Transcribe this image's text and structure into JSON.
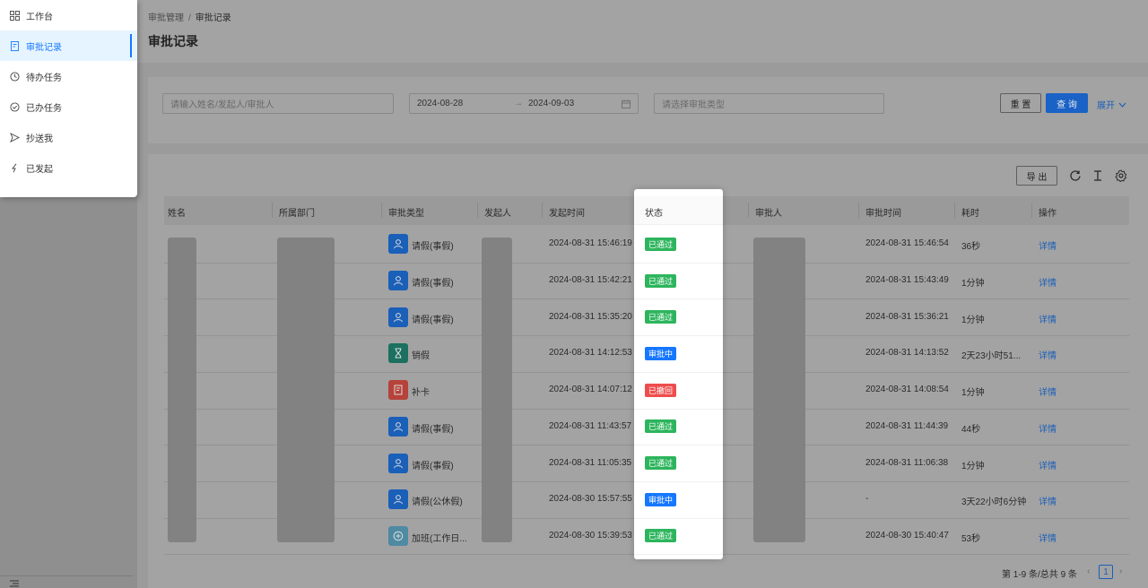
{
  "sidebar": {
    "items": [
      {
        "label": "工作台",
        "icon": "grid-icon",
        "active": false
      },
      {
        "label": "审批记录",
        "icon": "doc-icon",
        "active": true
      },
      {
        "label": "待办任务",
        "icon": "clock-icon",
        "active": false
      },
      {
        "label": "已办任务",
        "icon": "check-circle-icon",
        "active": false
      },
      {
        "label": "抄送我",
        "icon": "send-icon",
        "active": false
      },
      {
        "label": "已发起",
        "icon": "flash-icon",
        "active": false
      }
    ]
  },
  "breadcrumb": {
    "parent": "审批管理",
    "sep": "/",
    "current": "审批记录"
  },
  "page_title": "审批记录",
  "filters": {
    "name_placeholder": "请输入姓名/发起人/审批人",
    "date_start": "2024-08-28",
    "date_arrow": "→",
    "date_end": "2024-09-03",
    "type_placeholder": "请选择审批类型",
    "reset": "重 置",
    "search": "查 询",
    "expand": "展开"
  },
  "toolbar": {
    "export": "导 出"
  },
  "table": {
    "columns": [
      "姓名",
      "所属部门",
      "审批类型",
      "发起人",
      "发起时间",
      "状态",
      "审批人",
      "审批时间",
      "耗时",
      "操作"
    ],
    "rows": [
      {
        "type": "请假(事假)",
        "icon": "person-icon",
        "start": "2024-08-31 15:46:19",
        "status": "已通过",
        "approved": "2024-08-31 15:46:54",
        "duration": "36秒",
        "action": "详情"
      },
      {
        "type": "请假(事假)",
        "icon": "person-icon",
        "start": "2024-08-31 15:42:21",
        "status": "已通过",
        "approved": "2024-08-31 15:43:49",
        "duration": "1分钟",
        "action": "详情"
      },
      {
        "type": "请假(事假)",
        "icon": "person-icon",
        "start": "2024-08-31 15:35:20",
        "status": "已通过",
        "approved": "2024-08-31 15:36:21",
        "duration": "1分钟",
        "action": "详情"
      },
      {
        "type": "销假",
        "icon": "hourglass-icon",
        "start": "2024-08-31 14:12:53",
        "status": "审批中",
        "approved": "2024-08-31 14:13:52",
        "duration": "2天23小时51...",
        "action": "详情"
      },
      {
        "type": "补卡",
        "icon": "card-icon",
        "start": "2024-08-31 14:07:12",
        "status": "已撤回",
        "approved": "2024-08-31 14:08:54",
        "duration": "1分钟",
        "action": "详情"
      },
      {
        "type": "请假(事假)",
        "icon": "person-icon",
        "start": "2024-08-31 11:43:57",
        "status": "已通过",
        "approved": "2024-08-31 11:44:39",
        "duration": "44秒",
        "action": "详情"
      },
      {
        "type": "请假(事假)",
        "icon": "person-icon",
        "start": "2024-08-31 11:05:35",
        "status": "已通过",
        "approved": "2024-08-31 11:06:38",
        "duration": "1分钟",
        "action": "详情"
      },
      {
        "type": "请假(公休假)",
        "icon": "person-icon",
        "start": "2024-08-30 15:57:55",
        "status": "审批中",
        "approved": "-",
        "duration": "3天22小时6分钟",
        "action": "详情"
      },
      {
        "type": "加班(工作日...",
        "icon": "plus-circle-icon",
        "start": "2024-08-30 15:39:53",
        "status": "已通过",
        "approved": "2024-08-30 15:40:47",
        "duration": "53秒",
        "action": "详情"
      }
    ]
  },
  "pagination": {
    "summary": "第 1-9 条/总共 9 条",
    "current": "1"
  },
  "colors": {
    "primary": "#1677ff",
    "approved": "#2db55d",
    "pending": "#1677ff",
    "withdrawn": "#ee4d4d"
  }
}
